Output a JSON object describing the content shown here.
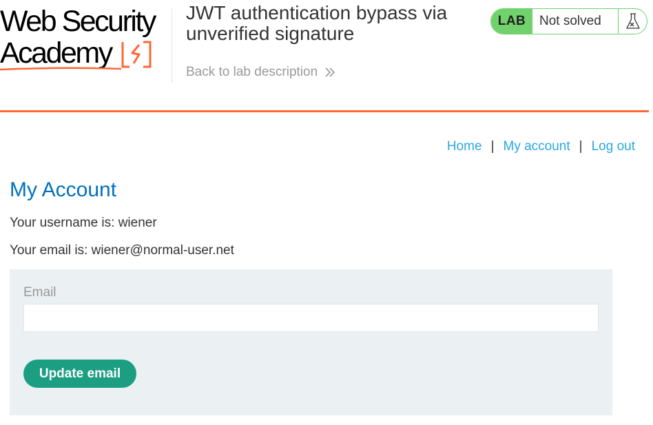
{
  "header": {
    "logo": {
      "line1": "Web Security",
      "line2": "Academy"
    },
    "lab_title": "JWT authentication bypass via unverified signature",
    "back_link": "Back to lab description",
    "lab_status": {
      "tag": "LAB",
      "status": "Not solved"
    }
  },
  "nav": {
    "home": "Home",
    "my_account": "My account",
    "log_out": "Log out",
    "separator": "|"
  },
  "main": {
    "heading": "My Account",
    "username_line": "Your username is: wiener",
    "email_line": "Your email is: wiener@normal-user.net",
    "form": {
      "email_label": "Email",
      "email_value": "",
      "button_label": "Update email"
    }
  },
  "colors": {
    "accent_orange": "#ff6633",
    "link_blue": "#29a8e0",
    "heading_blue": "#0071bc",
    "lab_green": "#70d16d",
    "button_teal": "#1b9e82",
    "form_background": "#ebf0f2"
  },
  "icons": {
    "logo_mark": "lightning-bolt-bracket-icon",
    "back_arrow": "double-chevron-right-icon",
    "lab_flask": "flask-icon"
  }
}
